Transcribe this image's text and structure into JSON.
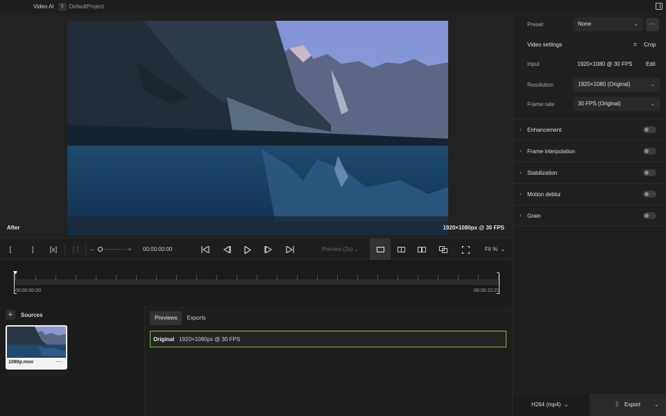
{
  "app": {
    "name": "Video AI",
    "project_count": "5",
    "project_name": "DefaultProject"
  },
  "viewer": {
    "mode_label": "After",
    "resolution_label": "1920×1080px @ 30 FPS"
  },
  "controls": {
    "timecode": "00:00:00:00",
    "preview_dropdown": "Preview (2s)",
    "zoom": "Fit %",
    "icons": [
      "mark-in-icon",
      "mark-out-icon",
      "clear-marks-icon",
      "marks-disabled-icon",
      "zoom-out-icon",
      "zoom-in-icon",
      "prev-keyframe-icon",
      "step-back-icon",
      "play-icon",
      "step-forward-icon",
      "next-keyframe-icon",
      "single-view-icon",
      "split-view-icon",
      "side-by-side-icon",
      "compare-icon",
      "fullscreen-icon"
    ]
  },
  "timeline": {
    "start": "00:00:00:00",
    "end": "00:00:22:27"
  },
  "sources": {
    "title": "Sources",
    "items": [
      {
        "name": "1080p.mov"
      }
    ]
  },
  "previews": {
    "tabs": [
      {
        "label": "Previews",
        "active": true
      },
      {
        "label": "Exports",
        "active": false
      }
    ],
    "rows": [
      {
        "label": "Original",
        "value": "1920×1080px @ 30 FPS"
      }
    ]
  },
  "right_panel": {
    "preset": {
      "label": "Preset",
      "value": "None"
    },
    "video_settings": {
      "title": "Video settings",
      "crop_label": "Crop"
    },
    "input": {
      "label": "Input",
      "value": "1920×1080 @ 30 FPS",
      "edit_label": "Edit"
    },
    "resolution": {
      "label": "Resolution",
      "value": "1920×1080 (Original)"
    },
    "frame_rate": {
      "label": "Frame rate",
      "value": "30 FPS (Original)"
    },
    "sections": [
      {
        "name": "Enhancement",
        "enabled": false
      },
      {
        "name": "Frame interpolation",
        "enabled": false
      },
      {
        "name": "Stabilization",
        "enabled": false
      },
      {
        "name": "Motion deblur",
        "enabled": false
      },
      {
        "name": "Grain",
        "enabled": false
      }
    ]
  },
  "export": {
    "codec": "H264 (mp4)",
    "button_label": "Export"
  },
  "colors": {
    "accent": "#7bc043",
    "export_icon": "#5fa8ff",
    "background": "#1b1b1b"
  }
}
